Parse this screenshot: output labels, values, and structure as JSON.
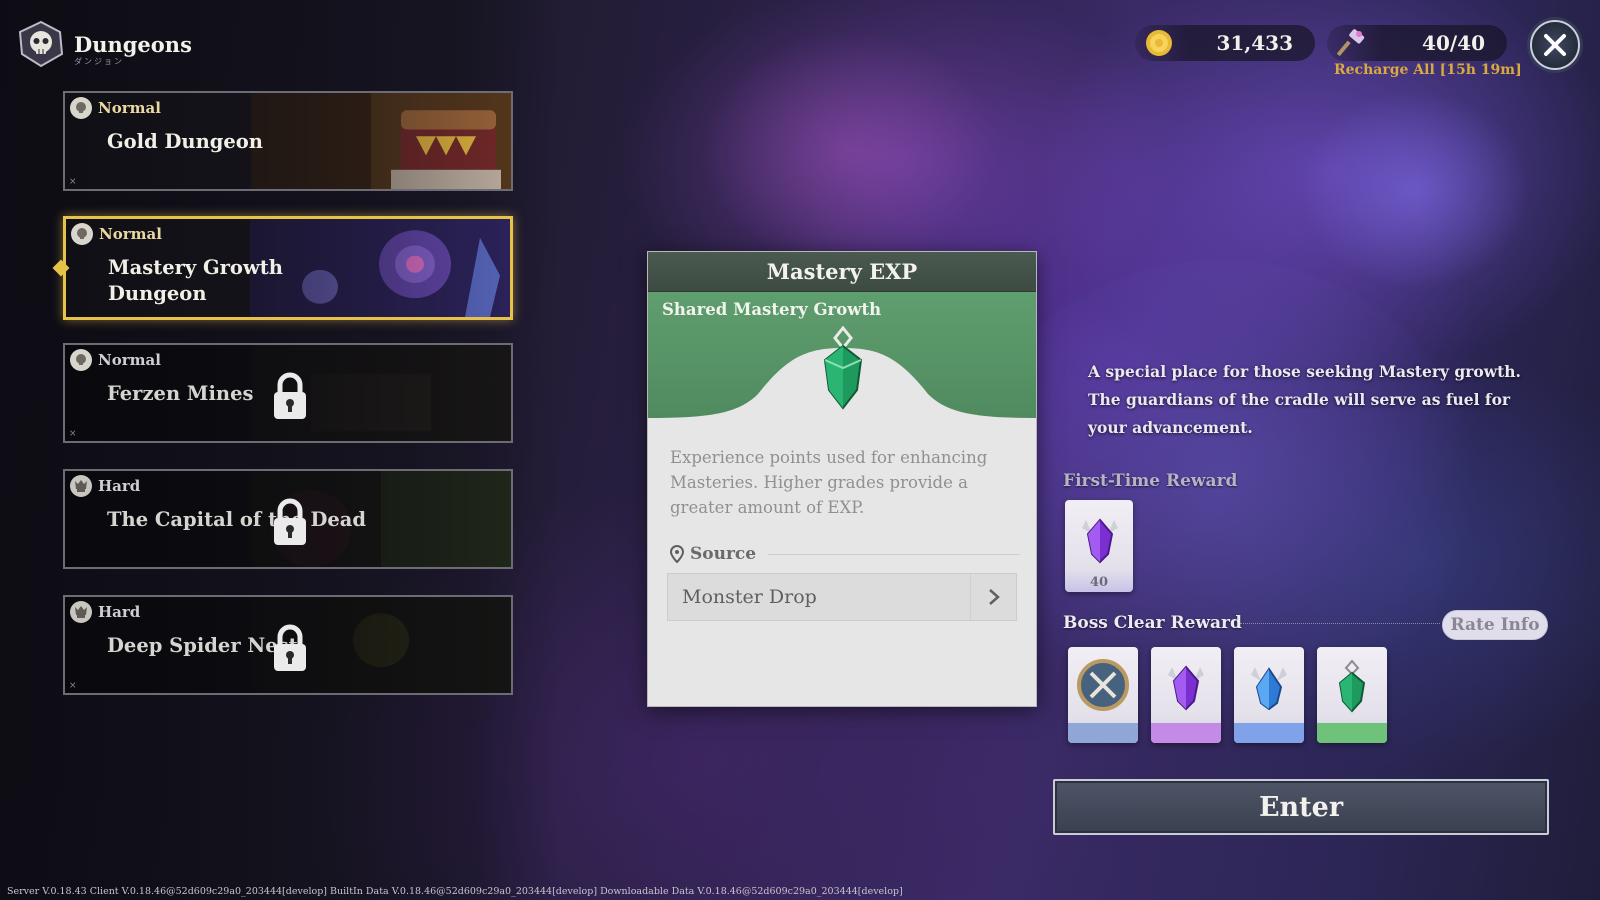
{
  "header": {
    "title": "Dungeons",
    "subtitle": "ダンジョン"
  },
  "dungeons": [
    {
      "difficulty": "Normal",
      "name_line1": "Gold Dungeon",
      "name_line2": "",
      "locked": false,
      "selected": false
    },
    {
      "difficulty": "Normal",
      "name_line1": "Mastery Growth",
      "name_line2": "Dungeon",
      "locked": false,
      "selected": true
    },
    {
      "difficulty": "Normal",
      "name_line1": "Ferzen Mines",
      "name_line2": "",
      "locked": true,
      "selected": false
    },
    {
      "difficulty": "Hard",
      "name_line1": "The Capital of the Dead",
      "name_line2": "",
      "locked": true,
      "selected": false
    },
    {
      "difficulty": "Hard",
      "name_line1": "Deep Spider Nest",
      "name_line2": "",
      "locked": true,
      "selected": false
    }
  ],
  "currency": {
    "gold": "31,433",
    "stamina": "40/40",
    "recharge": "Recharge All [15h 19m]"
  },
  "popup": {
    "title": "Mastery EXP",
    "subtitle": "Shared Mastery Growth",
    "description": "Experience points used for enhancing Masteries. Higher grades provide a greater amount of EXP.",
    "source_label": "Source",
    "source_value": "Monster Drop"
  },
  "info": {
    "description": "A special place for those seeking Mastery growth. The guardians of the cradle will serve as fuel for your advancement.",
    "first_time_reward_label": "First-Time Reward",
    "first_time_reward_count": "40",
    "boss_clear_reward_label": "Boss Clear Reward",
    "rate_info_label": "Rate Info",
    "enter_label": "Enter"
  },
  "footer": "Server V.0.18.43 Client V.0.18.46@52d609c29a0_203444[develop] BuiltIn Data V.0.18.46@52d609c29a0_203444[develop] Downloadable Data V.0.18.46@52d609c29a0_203444[develop]",
  "colors": {
    "selected_border": "#e7c24a",
    "popup_header": "#3d4b42",
    "popup_green": "#5f9e6e",
    "recharge": "#d8a93f"
  }
}
